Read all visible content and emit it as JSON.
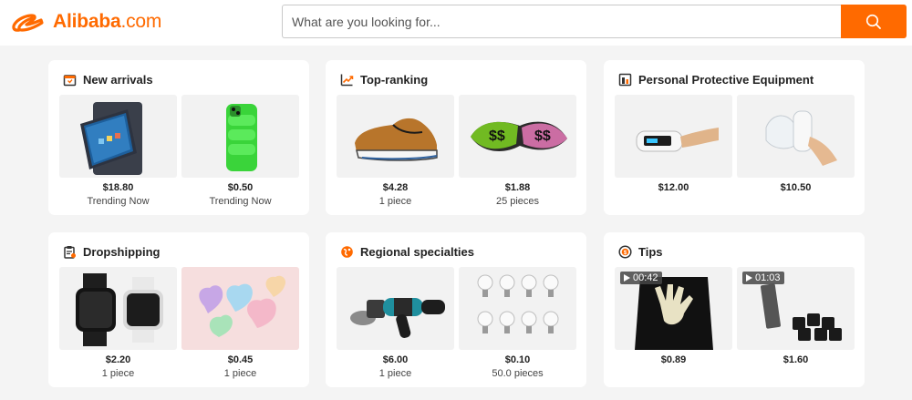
{
  "header": {
    "logo_text": "Alibaba",
    "logo_suffix": ".com",
    "search_placeholder": "What are you looking for..."
  },
  "colors": {
    "brand": "#ff6a00"
  },
  "cards": [
    {
      "title": "New arrivals",
      "icon": "new-arrivals-icon",
      "products": [
        {
          "price": "$18.80",
          "sub": "Trending Now",
          "image": "tablet-image"
        },
        {
          "price": "$0.50",
          "sub": "Trending Now",
          "image": "green-phone-case-image"
        }
      ]
    },
    {
      "title": "Top-ranking",
      "icon": "trending-up-icon",
      "products": [
        {
          "price": "$4.28",
          "sub": "1 piece",
          "image": "brown-shoe-image"
        },
        {
          "price": "$1.88",
          "sub": "25 pieces",
          "image": "bandana-fabric-image"
        }
      ]
    },
    {
      "title": "Personal Protective Equipment",
      "icon": "ppe-icon",
      "products": [
        {
          "price": "$12.00",
          "sub": "",
          "image": "pulse-oximeter-image"
        },
        {
          "price": "$10.50",
          "sub": "",
          "image": "nebulizer-image"
        }
      ]
    },
    {
      "title": "Dropshipping",
      "icon": "clipboard-icon",
      "products": [
        {
          "price": "$2.20",
          "sub": "1 piece",
          "image": "smartwatch-image"
        },
        {
          "price": "$0.45",
          "sub": "1 piece",
          "image": "heart-soap-image"
        }
      ]
    },
    {
      "title": "Regional specialties",
      "icon": "globe-icon",
      "products": [
        {
          "price": "$6.00",
          "sub": "1 piece",
          "image": "angle-grinder-image"
        },
        {
          "price": "$0.10",
          "sub": "50.0 pieces",
          "image": "led-bulbs-image"
        }
      ]
    },
    {
      "title": "Tips",
      "icon": "tips-icon",
      "products": [
        {
          "price": "$0.89",
          "sub": "",
          "image": "glove-image",
          "video_duration": "00:42"
        },
        {
          "price": "$1.60",
          "sub": "",
          "image": "charcoal-image",
          "video_duration": "01:03"
        }
      ]
    }
  ]
}
